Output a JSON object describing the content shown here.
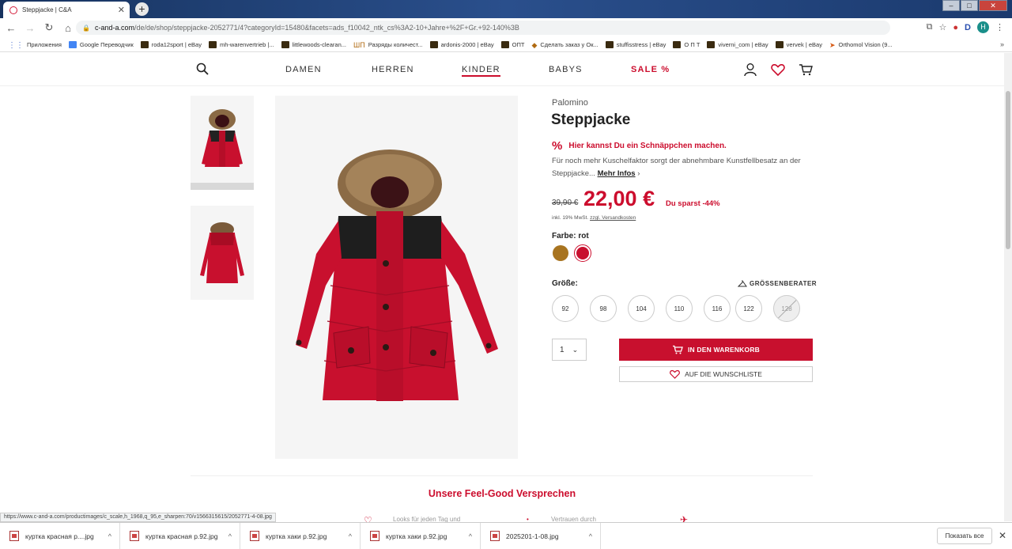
{
  "browser": {
    "tab_title": "Steppjacke | C&A",
    "url_domain": "c-and-a.com",
    "url_rest": "/de/de/shop/steppjacke-2052771/4?categoryId=15480&facets=ads_f10042_ntk_cs%3A2-10+Jahre+%2F+Gr.+92-140%3B",
    "profile_initial": "H",
    "bookmarks": [
      {
        "label": "Приложения",
        "icon": "apps-icon"
      },
      {
        "label": "Google Переводчик",
        "icon": "translate-icon"
      },
      {
        "label": "roda12sport | eBay",
        "icon": "shopping-bag-icon"
      },
      {
        "label": "mh-warenvertrieb |...",
        "icon": "shopping-bag-icon"
      },
      {
        "label": "littlewoods-clearan...",
        "icon": "shopping-bag-icon"
      },
      {
        "label": "Разряды количест...",
        "icon": "shop-icon"
      },
      {
        "label": "ardonis-2000 | eBay",
        "icon": "shopping-bag-icon"
      },
      {
        "label": "ОПТ",
        "icon": "shopping-bag-icon"
      },
      {
        "label": "Сделать заказ у Ок...",
        "icon": "box-icon"
      },
      {
        "label": "stuffisstress | eBay",
        "icon": "shopping-bag-icon"
      },
      {
        "label": "О П Т",
        "icon": "shopping-bag-icon"
      },
      {
        "label": "viverni_com | eBay",
        "icon": "shopping-bag-icon"
      },
      {
        "label": "vervek | eBay",
        "icon": "shopping-bag-icon"
      },
      {
        "label": "Orthomol Vision (9...",
        "icon": "orthomol-icon"
      }
    ],
    "bookmarks_more": "»",
    "status_url": "https://www.c-and-a.com/productimages/c_scale,h_1968,q_95,e_sharpen:70/v1566315615/2052771-4-08.jpg"
  },
  "nav": {
    "items": [
      "DAMEN",
      "HERREN",
      "KINDER",
      "BABYS",
      "SALE %"
    ],
    "active": "KINDER"
  },
  "product": {
    "brand": "Palomino",
    "title": "Steppjacke",
    "deal_icon": "%",
    "deal_text": "Hier kannst Du ein Schnäppchen machen.",
    "description": "Für noch mehr Kuschelfaktor sorgt der abnehmbare Kunstfellbesatz an der Steppjacke...",
    "more_info": "Mehr Infos",
    "old_price": "39,90 €",
    "price": "22,00 €",
    "saving": "Du sparst -44%",
    "vat_text": "inkl. 19% MwSt.",
    "shipping_link": "zzgl. Versandkosten",
    "color_label": "Farbe: rot",
    "colors": [
      {
        "name": "braun",
        "hex": "#a87420"
      },
      {
        "name": "rot",
        "hex": "#c8102e",
        "selected": true
      }
    ],
    "size_label": "Größe:",
    "size_advisor": "GRÖSSENBERATER",
    "sizes": [
      "92",
      "98",
      "104",
      "110",
      "116",
      "122",
      "128"
    ],
    "unavailable_size": "128",
    "quantity": "1",
    "add_to_cart": "IN DEN WARENKORB",
    "wishlist": "AUF DIE WUNSCHLISTE"
  },
  "promise": {
    "heading": "Unsere Feel-Good Versprechen",
    "peek_1": "Looks für jeden Tag und",
    "peek_2": "Vertrauen durch"
  },
  "downloads": {
    "items": [
      "куртка красная р....jpg",
      "куртка красная р.92.jpg",
      "куртка хаки р.92.jpg",
      "куртка хаки р.92.jpg",
      "2025201-1-08.jpg"
    ],
    "show_all": "Показать все"
  },
  "colors": {
    "brand_red": "#cc0d2d",
    "button_red": "#c8102e"
  }
}
